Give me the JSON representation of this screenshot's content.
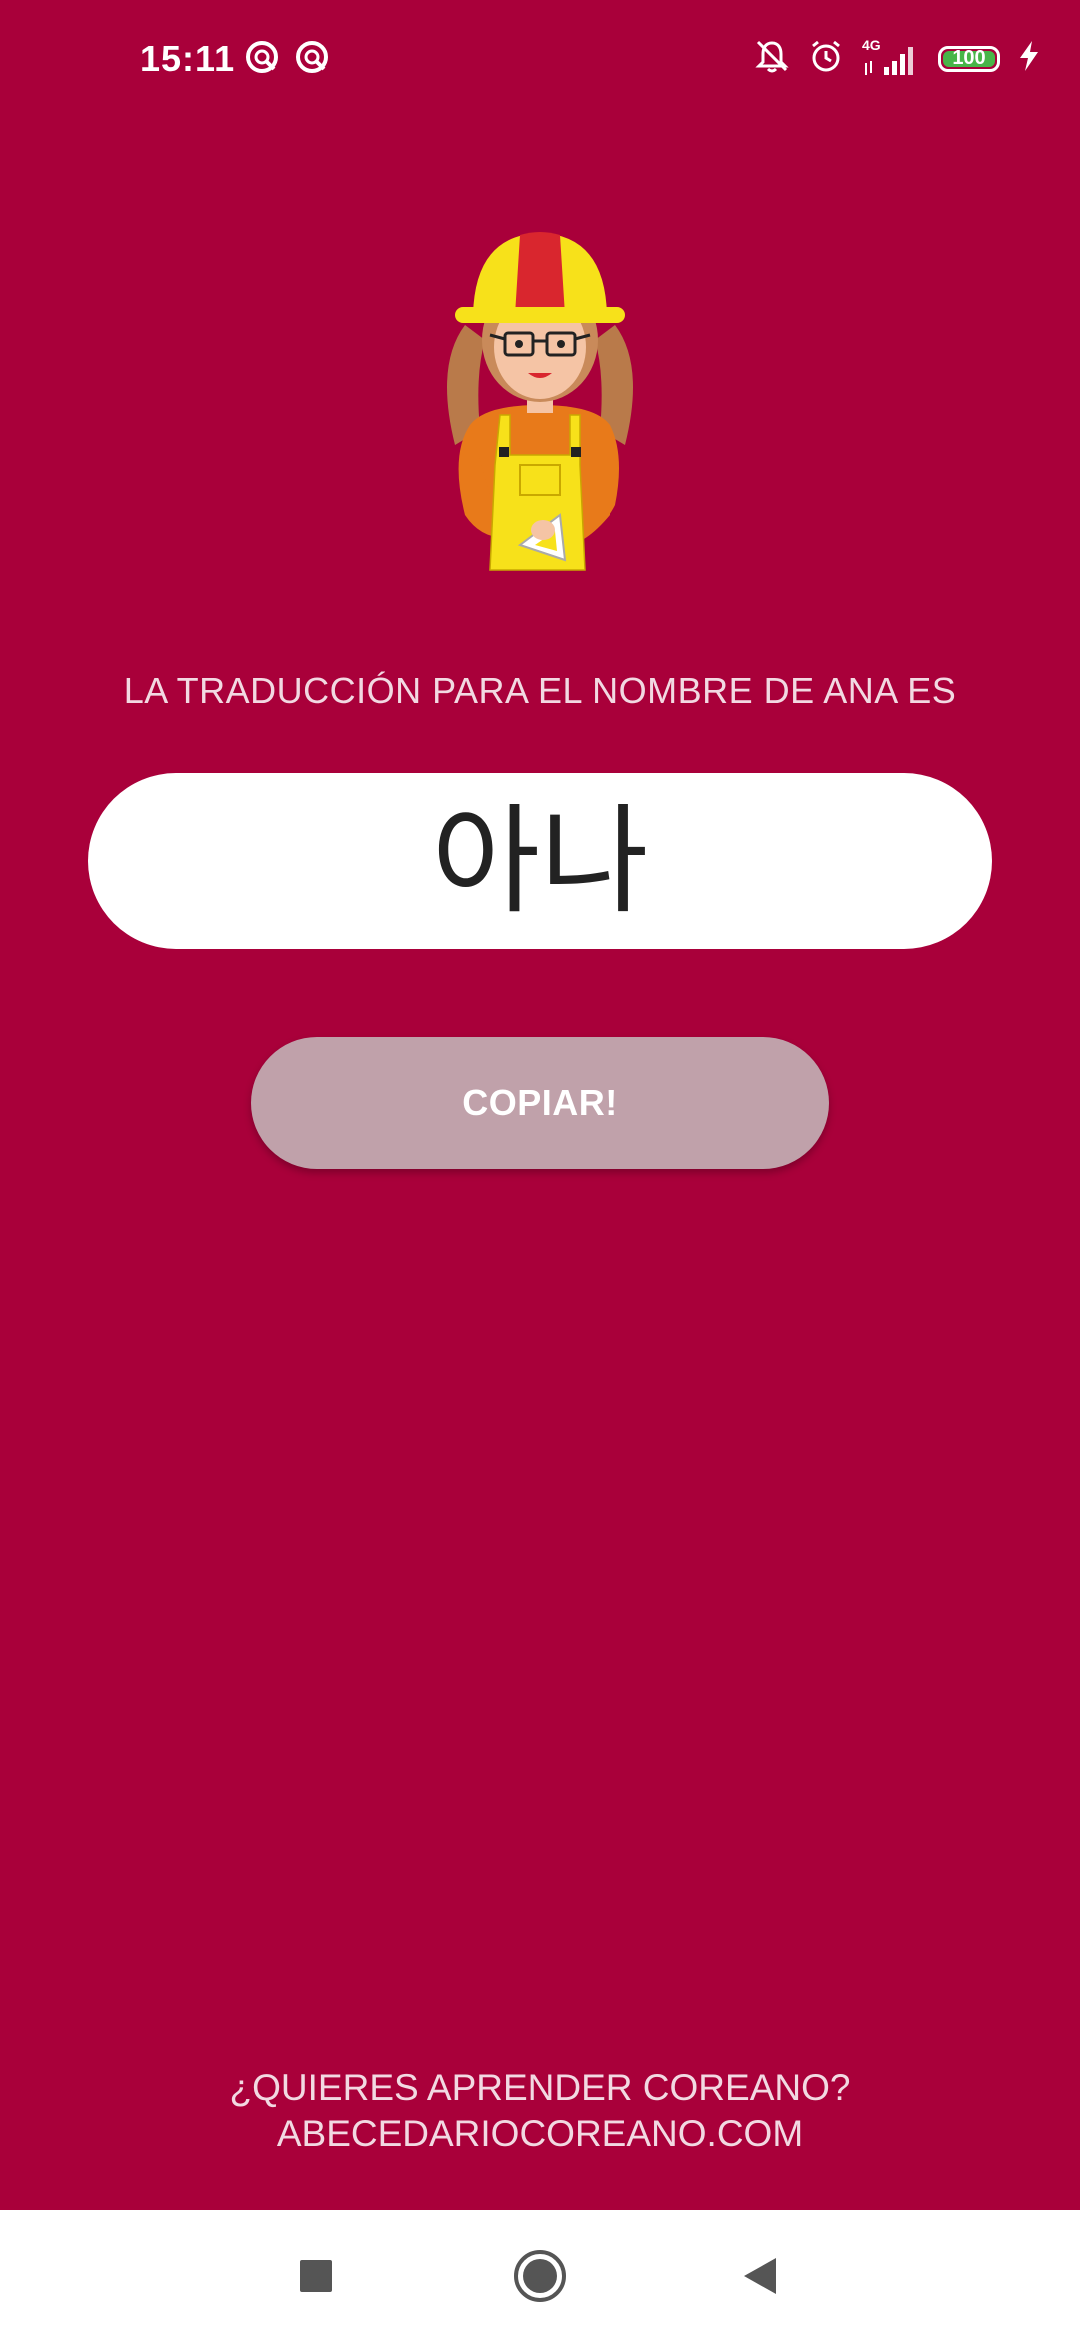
{
  "status_bar": {
    "time": "15:11",
    "battery_level": "100",
    "network": "4G",
    "icons_left": [
      "notification-app-icon",
      "notification-app-icon"
    ],
    "icons_right": [
      "silent-bell-icon",
      "alarm-icon",
      "signal-icon",
      "battery-icon",
      "charging-icon"
    ]
  },
  "main": {
    "heading": "LA TRADUCCIÓN PARA EL NOMBRE DE ANA ES",
    "translation": "아나",
    "copy_button_label": "COPIAR!"
  },
  "footer": {
    "line1": "¿QUIERES APRENDER COREANO?",
    "line2": "ABECEDARIOCOREANO.COM"
  },
  "nav_bar": {
    "buttons": [
      "recent-apps-icon",
      "home-icon",
      "back-icon"
    ]
  },
  "colors": {
    "background": "#a9003a",
    "button": "#c0a1aa",
    "text_light": "#f2d9e2",
    "battery_fill": "#48b548"
  }
}
